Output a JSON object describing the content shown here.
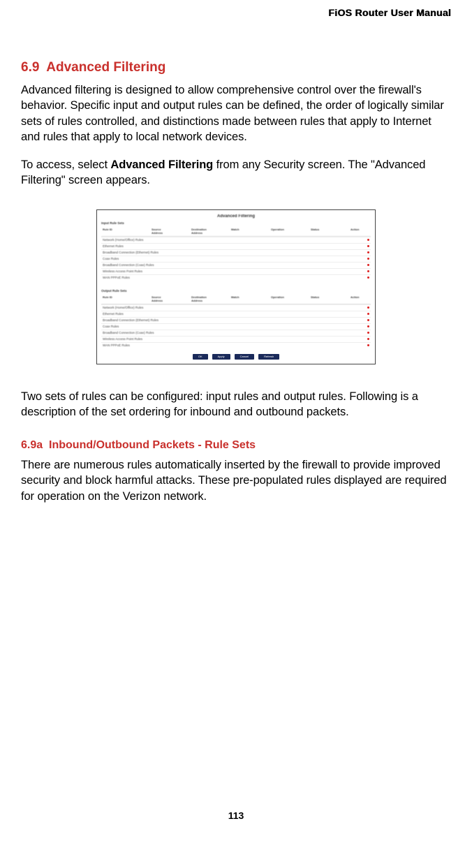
{
  "doc": {
    "header": "FiOS Router User Manual",
    "page_number": "113"
  },
  "section": {
    "number": "6.9",
    "title": "Advanced Filtering",
    "intro": "Advanced filtering is designed to allow comprehensive control over the firewall's behavior. Specific input and output rules can be defined, the order of logically similar sets of rules controlled, and distinctions made between rules that apply to Internet and rules that apply to local network devices.",
    "access_pre": "To access, select ",
    "access_bold": "Advanced Filtering",
    "access_post": " from any Security screen. The \"Advanced Filtering\" screen appears.",
    "after_image": "Two sets of rules can be configured: input rules and output rules. Following is a description of the set ordering for inbound and outbound packets."
  },
  "subsection": {
    "number": "6.9a",
    "title": "Inbound/Outbound Packets - Rule Sets",
    "body": "There are numerous rules automatically inserted by the firewall to provide improved security and block harmful attacks. These pre-populated rules displayed are required for operation on the Verizon network."
  },
  "screenshot": {
    "title": "Advanced Filtering",
    "note": "",
    "input_section": "Input Rule Sets",
    "output_section": "Output Rule Sets",
    "columns": [
      "Rule ID",
      "Source Address",
      "Destination Address",
      "Match",
      "Operation",
      "Status",
      "Action"
    ],
    "input_rows": [
      "Network (Home/Office) Rules",
      "Ethernet Rules",
      "Broadband Connection (Ethernet) Rules",
      "Coax Rules",
      "Broadband Connection (Coax) Rules",
      "Wireless Access Point Rules",
      "WAN PPPoE Rules"
    ],
    "output_rows": [
      "Network (Home/Office) Rules",
      "Ethernet Rules",
      "Broadband Connection (Ethernet) Rules",
      "Coax Rules",
      "Broadband Connection (Coax) Rules",
      "Wireless Access Point Rules",
      "WAN PPPoE Rules"
    ],
    "buttons": [
      "OK",
      "Apply",
      "Cancel",
      "Refresh"
    ]
  }
}
